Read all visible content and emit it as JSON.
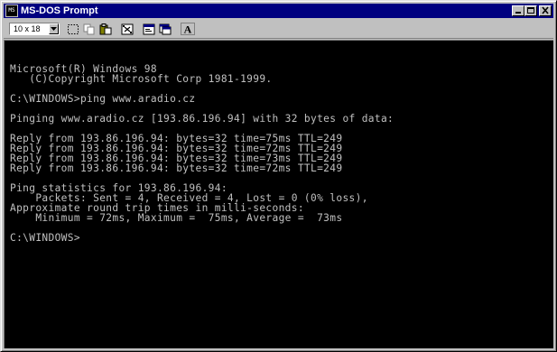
{
  "window": {
    "title": "MS-DOS Prompt",
    "icon_label": "MS"
  },
  "caption_buttons": [
    "minimize-icon",
    "maximize-icon",
    "close-icon"
  ],
  "toolbar": {
    "font_size_value": "10 x 18",
    "buttons": [
      "mark-icon",
      "copy-icon",
      "paste-icon",
      "fullscreen-icon",
      "properties-icon",
      "background-icon",
      "font-icon"
    ],
    "font_button_label": "A"
  },
  "console": {
    "lines": [
      "Microsoft(R) Windows 98",
      "   (C)Copyright Microsoft Corp 1981-1999.",
      "",
      "C:\\WINDOWS>ping www.aradio.cz",
      "",
      "Pinging www.aradio.cz [193.86.196.94] with 32 bytes of data:",
      "",
      "Reply from 193.86.196.94: bytes=32 time=75ms TTL=249",
      "Reply from 193.86.196.94: bytes=32 time=72ms TTL=249",
      "Reply from 193.86.196.94: bytes=32 time=73ms TTL=249",
      "Reply from 193.86.196.94: bytes=32 time=72ms TTL=249",
      "",
      "Ping statistics for 193.86.196.94:",
      "    Packets: Sent = 4, Received = 4, Lost = 0 (0% loss),",
      "Approximate round trip times in milli-seconds:",
      "    Minimum = 72ms, Maximum =  75ms, Average =  73ms",
      "",
      "C:\\WINDOWS>"
    ]
  },
  "colors": {
    "titlebar": "#000080",
    "console_background": "#000000",
    "console_text": "#c0c0c0",
    "chrome": "#c0c0c0"
  }
}
